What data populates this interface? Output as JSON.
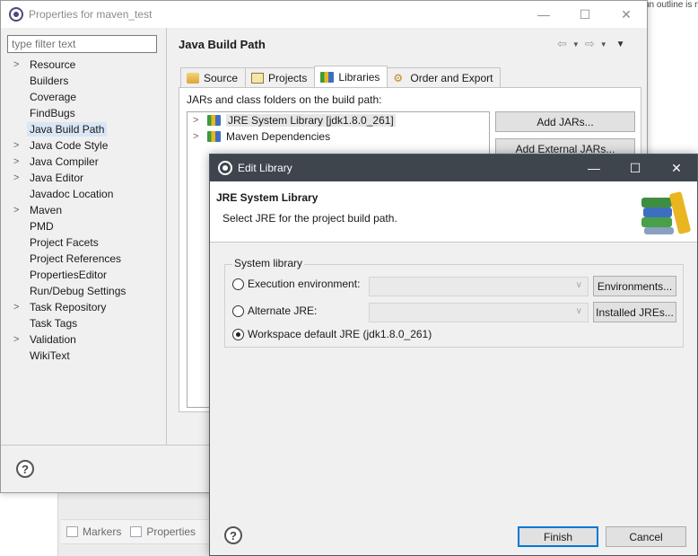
{
  "background": {
    "corner_text": "un outline is no",
    "bottom_tabs": [
      {
        "label": "Markers",
        "icon": "markers-icon"
      },
      {
        "label": "Properties",
        "icon": "properties-icon"
      }
    ]
  },
  "properties_window": {
    "title": "Properties for maven_test",
    "filter_placeholder": "type filter text",
    "tree": [
      {
        "label": "Resource",
        "expandable": true
      },
      {
        "label": "Builders",
        "expandable": false
      },
      {
        "label": "Coverage",
        "expandable": false
      },
      {
        "label": "FindBugs",
        "expandable": false
      },
      {
        "label": "Java Build Path",
        "expandable": false,
        "selected": true
      },
      {
        "label": "Java Code Style",
        "expandable": true
      },
      {
        "label": "Java Compiler",
        "expandable": true
      },
      {
        "label": "Java Editor",
        "expandable": true
      },
      {
        "label": "Javadoc Location",
        "expandable": false
      },
      {
        "label": "Maven",
        "expandable": true
      },
      {
        "label": "PMD",
        "expandable": false
      },
      {
        "label": "Project Facets",
        "expandable": false
      },
      {
        "label": "Project References",
        "expandable": false
      },
      {
        "label": "PropertiesEditor",
        "expandable": false
      },
      {
        "label": "Run/Debug Settings",
        "expandable": false
      },
      {
        "label": "Task Repository",
        "expandable": true
      },
      {
        "label": "Task Tags",
        "expandable": false
      },
      {
        "label": "Validation",
        "expandable": true
      },
      {
        "label": "WikiText",
        "expandable": false
      }
    ],
    "page_title": "Java Build Path",
    "tabs": [
      {
        "label": "Source",
        "icon": "source-folder-icon"
      },
      {
        "label": "Projects",
        "icon": "projects-icon"
      },
      {
        "label": "Libraries",
        "icon": "libraries-icon",
        "active": true
      },
      {
        "label": "Order and Export",
        "icon": "order-export-icon"
      }
    ],
    "panel_label": "JARs and class folders on the build path:",
    "libraries": [
      {
        "label": "JRE System Library [jdk1.8.0_261]",
        "selected": true
      },
      {
        "label": "Maven Dependencies",
        "selected": false
      }
    ],
    "buttons": {
      "add_jars": "Add JARs...",
      "add_external_jars": "Add External JARs..."
    },
    "help_symbol": "?"
  },
  "edit_library_dialog": {
    "title": "Edit Library",
    "header_title": "JRE System Library",
    "header_message": "Select JRE for the project build path.",
    "group_title": "System library",
    "options": {
      "execution_environment": {
        "label": "Execution environment:",
        "selected": false,
        "combo_value": "",
        "button": "Environments..."
      },
      "alternate_jre": {
        "label": "Alternate JRE:",
        "selected": false,
        "combo_value": "",
        "button": "Installed JREs..."
      },
      "workspace_default": {
        "label": "Workspace default JRE (jdk1.8.0_261)",
        "selected": true
      }
    },
    "buttons": {
      "finish": "Finish",
      "cancel": "Cancel"
    },
    "help_symbol": "?"
  },
  "window_controls": {
    "minimize": "—",
    "maximize": "☐",
    "close": "✕"
  },
  "colors": {
    "dialog_titlebar": "#3e454d",
    "selection": "#d9e6f5",
    "default_button_border": "#0078d7"
  }
}
